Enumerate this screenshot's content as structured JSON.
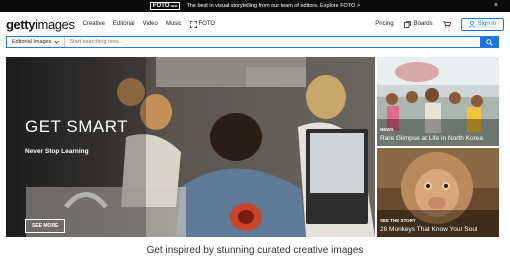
{
  "promo": {
    "brand": "FOTO",
    "brand_sup": "NEW",
    "text": "The best in visual storytelling from our team of editors. Explore FOTO  >",
    "close": "×"
  },
  "nav": {
    "logo_bold": "getty",
    "logo_light": "images",
    "links": [
      "Creative",
      "Editorial",
      "Video",
      "Music"
    ],
    "foto_link": "FOTO",
    "pricing": "Pricing",
    "boards": "Boards",
    "signin": "Sign in"
  },
  "search": {
    "filter": "Editorial Images",
    "placeholder": "Start searching now..."
  },
  "hero": {
    "title": "GET SMART",
    "subtitle": "Never Stop Learning",
    "button": "SEE MORE"
  },
  "tiles": [
    {
      "tag": "NEWS",
      "caption": "Rare Glimpse at Life in North Korea"
    },
    {
      "tag": "SEE THE STORY",
      "caption": "28 Monkeys That Know Your Soul"
    }
  ],
  "tagline": "Get inspired by stunning curated creative images",
  "colors": {
    "accent": "#1a73e8",
    "promo_bg": "#0b0b0b"
  }
}
